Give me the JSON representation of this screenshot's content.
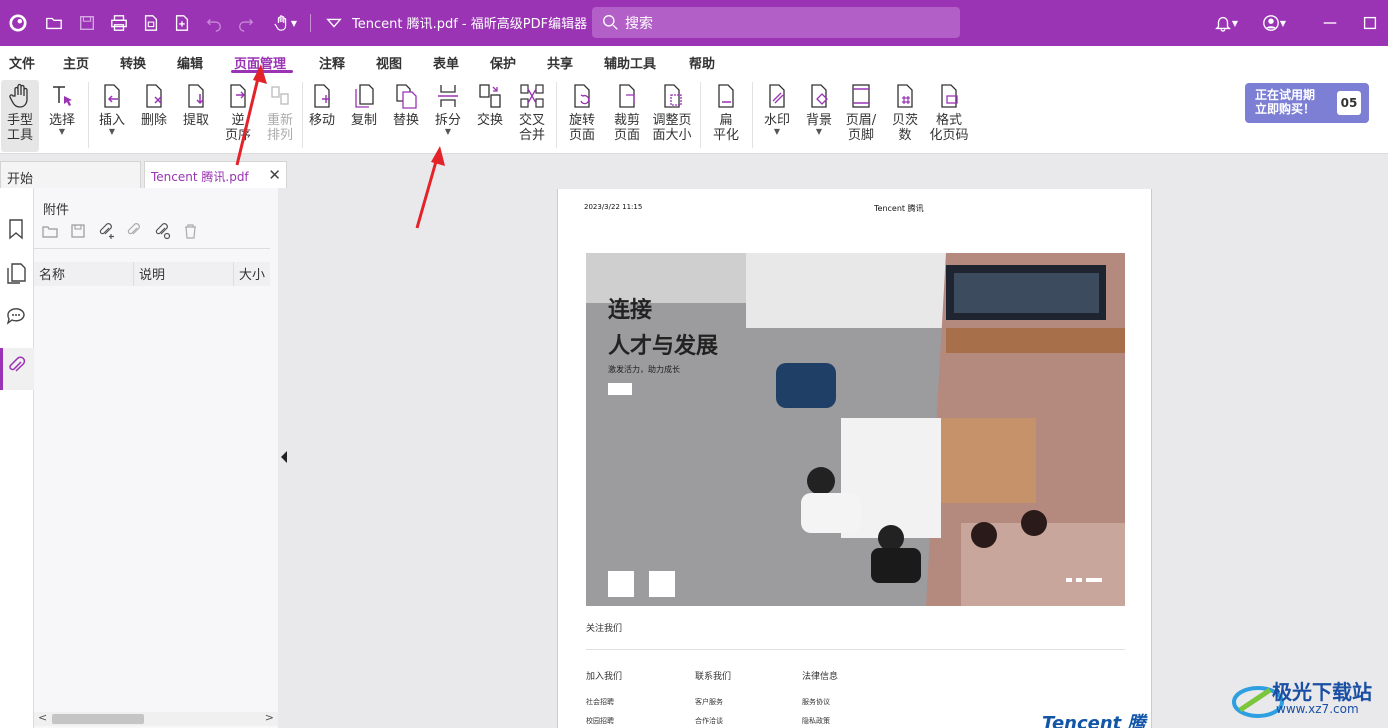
{
  "titlebar": {
    "title": "Tencent 腾讯.pdf - 福昕高级PDF编辑器",
    "search_placeholder": "搜索",
    "bg_color": "#9a33b4"
  },
  "menu": [
    "文件",
    "主页",
    "转换",
    "编辑",
    "页面管理",
    "注释",
    "视图",
    "表单",
    "保护",
    "共享",
    "辅助工具",
    "帮助"
  ],
  "menu_active": "页面管理",
  "ribbon": {
    "hand": "手型\n工具",
    "select": "选择",
    "insert": "插入",
    "delete": "删除",
    "extract": "提取",
    "reverse": "逆\n页序",
    "rearrange": "重新\n排列",
    "move": "移动",
    "copy": "复制",
    "replace": "替换",
    "split": "拆分",
    "swap": "交换",
    "cross_merge": "交叉\n合并",
    "rotate": "旋转\n页面",
    "crop": "裁剪\n页面",
    "resize": "调整页\n面大小",
    "flatten": "扁\n平化",
    "watermark": "水印",
    "background": "背景",
    "header_footer": "页眉/\n页脚",
    "bates": "贝茨\n数",
    "format_page_num": "格式\n化页码"
  },
  "trial": {
    "text": "正在试用期\n立即购买！",
    "days": "05"
  },
  "tabs": {
    "home": "开始",
    "doc": "Tencent 腾讯.pdf"
  },
  "panel": {
    "title": "附件",
    "col_name": "名称",
    "col_desc": "说明",
    "col_size": "大小"
  },
  "page": {
    "date": "2023/3/22 11:15",
    "header": "Tencent 腾讯",
    "hero_line1": "连接",
    "hero_line2": "人才与发展",
    "hero_sub": "激发活力，助力成长",
    "follow": "关注我们",
    "col1_title": "加入我们",
    "col1_items": [
      "社会招聘",
      "校园招聘"
    ],
    "col2_title": "联系我们",
    "col2_items": [
      "客户服务",
      "合作洽谈"
    ],
    "col3_title": "法律信息",
    "col3_items": [
      "服务协议",
      "隐私政策"
    ],
    "logo": "Tencent 腾"
  },
  "watermark": {
    "line1": "极光下载站",
    "line2": "www.xz7.com"
  }
}
